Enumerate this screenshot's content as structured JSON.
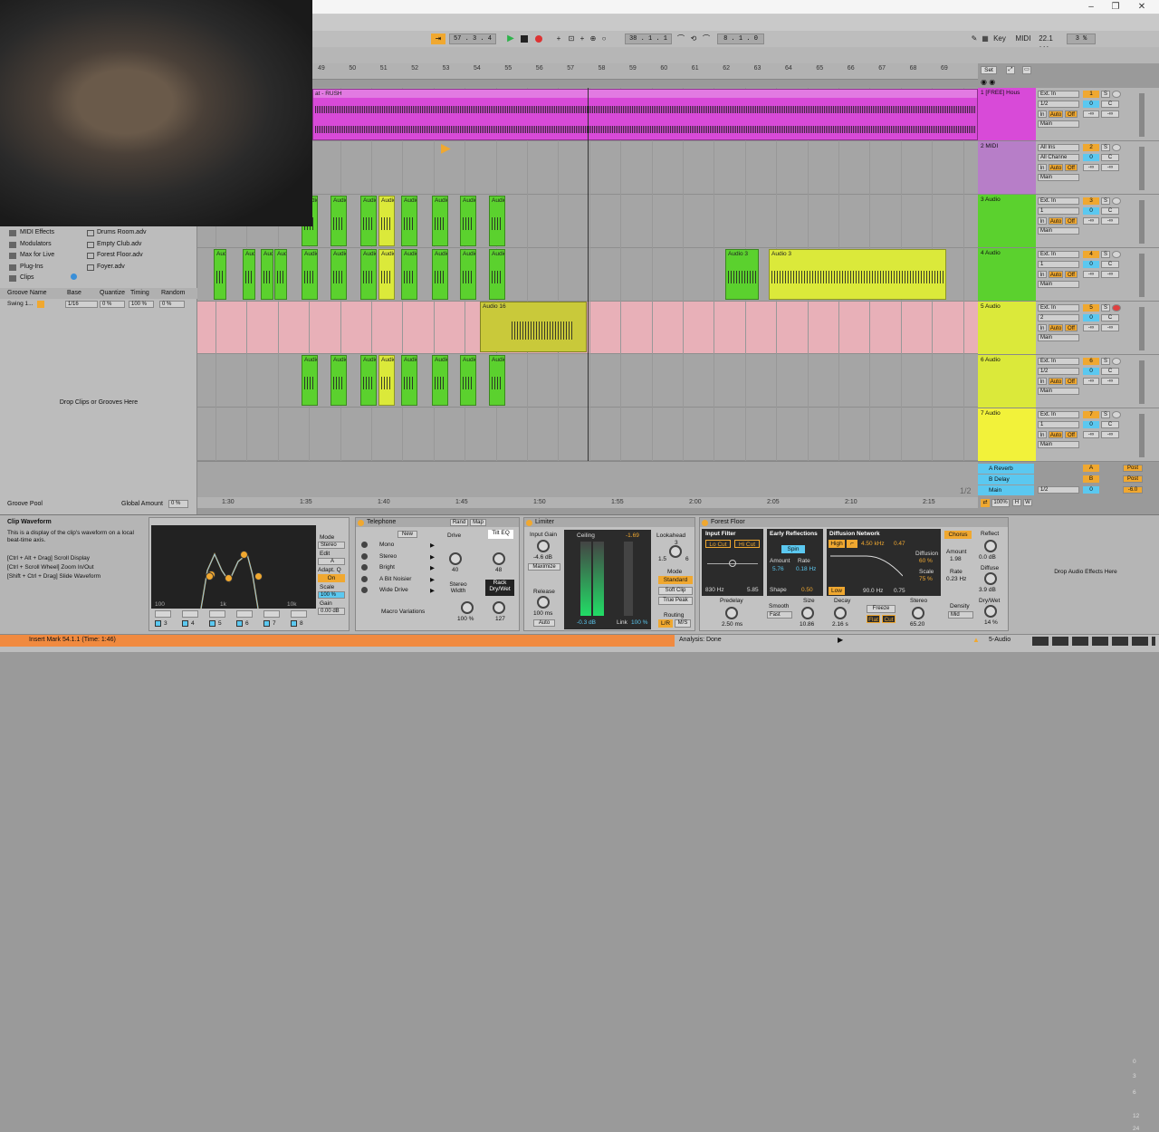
{
  "window": {
    "minimize": "–",
    "restore": "❐",
    "close": "✕"
  },
  "transport": {
    "position": "57 . 3 . 4",
    "loop_start": "38 . 1 . 1",
    "loop_length": "8 . 1 . 0",
    "key": "Key",
    "midi": "MIDI",
    "sample_rate": "22.1 kHz",
    "cpu": "3 %"
  },
  "ruler": {
    "bars": [
      "49",
      "50",
      "51",
      "52",
      "53",
      "54",
      "55",
      "56",
      "57",
      "58",
      "59",
      "60",
      "61",
      "62",
      "63",
      "64",
      "65",
      "66",
      "67",
      "68",
      "69"
    ],
    "set_label": "Set"
  },
  "time_axis": [
    "1:30",
    "1:35",
    "1:40",
    "1:45",
    "1:50",
    "1:55",
    "2:00",
    "2:05",
    "2:10",
    "2:15"
  ],
  "page_indicator": "1/2",
  "clips": {
    "rush": "at - RUSH",
    "audio": "Audio",
    "audio_short": "Aud",
    "audio_a": "Au",
    "audio3": "Audio 3",
    "audio16": "Audio 16"
  },
  "tracks": [
    {
      "name": "1 [FREE] Hous",
      "input": "Ext. In",
      "channel": "1/2",
      "number": "1",
      "out": "Main",
      "color": "#d84ad8"
    },
    {
      "name": "2 MIDI",
      "input": "All Ins",
      "channel": "All Channe",
      "number": "2",
      "out": "Main",
      "color": "#b77ec8"
    },
    {
      "name": "3 Audio",
      "input": "Ext. In",
      "channel": "1",
      "number": "3",
      "out": "Main",
      "color": "#5bd12e"
    },
    {
      "name": "4 Audio",
      "input": "Ext. In",
      "channel": "1",
      "number": "4",
      "out": "Main",
      "color": "#5bd12e"
    },
    {
      "name": "5 Audio",
      "input": "Ext. In",
      "channel": "2",
      "number": "5",
      "out": "Main",
      "color": "#dbe93a"
    },
    {
      "name": "6 Audio",
      "input": "Ext. In",
      "channel": "1/2",
      "number": "6",
      "out": "Main",
      "color": "#dbe93a"
    },
    {
      "name": "7 Audio",
      "input": "Ext. In",
      "channel": "1",
      "number": "7",
      "out": "Main",
      "color": "#f2f23a"
    }
  ],
  "monitor": {
    "in": "In",
    "auto": "Auto",
    "off": "Off",
    "zero": "0",
    "c": "C",
    "inf": "-∞",
    "s": "S"
  },
  "returns": [
    {
      "name": "A Reverb",
      "letter": "A",
      "post": "Post"
    },
    {
      "name": "B Delay",
      "letter": "B",
      "post": "Post"
    },
    {
      "name": "Main",
      "letter": "0",
      "post": "-6.0"
    }
  ],
  "main_row": {
    "zoom": "100%",
    "h": "H",
    "w": "W",
    "out": "1/2"
  },
  "browser": {
    "items": [
      "MIDI Effects",
      "Modulators",
      "Max for Live",
      "Plug-Ins",
      "Clips"
    ],
    "files": [
      "Drums Room.adv",
      "Empty Club.adv",
      "Forest Floor.adv",
      "Foyer.adv"
    ],
    "groove_headers": [
      "Groove Name",
      "Base",
      "Quantize",
      "Timing",
      "Random"
    ],
    "groove_row": {
      "name": "Swing 1...",
      "base": "1/16",
      "quantize": "0 %",
      "timing": "100 %",
      "random": "0 %"
    },
    "drop_text": "Drop Clips or Grooves Here",
    "pool_label": "Groove Pool",
    "global_amount_label": "Global Amount",
    "global_amount": "0 %"
  },
  "info": {
    "title": "Clip Waveform",
    "body": "This is a display of the clip's waveform on a local beat-time axis.",
    "shortcuts": [
      "[Ctrl + Alt + Drag] Scroll Display",
      "[Ctrl + Scroll Wheel] Zoom In/Out",
      "[Shift + Ctrl + Drag] Slide Waveform"
    ]
  },
  "eq": {
    "freq_labels": [
      "100",
      "1k",
      "10k"
    ],
    "mode_label": "Mode",
    "mode": "Stereo",
    "edit_label": "Edit",
    "edit": "A",
    "adapt_label": "Adapt. Q",
    "adapt": "On",
    "scale_label": "Scale",
    "scale": "100 %",
    "gain_label": "Gain",
    "gain": "0.00 dB",
    "bands": [
      "3",
      "4",
      "5",
      "6",
      "7",
      "8"
    ]
  },
  "telephone": {
    "title": "Telephone",
    "new": "New",
    "rand": "Rand",
    "map": "Map",
    "presets": [
      "Mono",
      "Stereo",
      "Bright",
      "A Bit Noisier",
      "Wide Drive"
    ],
    "drive_label": "Drive",
    "drive": "40",
    "tilt_label": "Tilt EQ",
    "tilt": "48",
    "width_label": "Stereo Width",
    "width": "100 %",
    "rack_label": "Rack Dry/Wet",
    "rack": "127",
    "macro": "Macro Variations"
  },
  "limiter": {
    "title": "Limiter",
    "input_gain_label": "Input Gain",
    "input_gain": "-4.6 dB",
    "maximize": "Maximize",
    "release_label": "Release",
    "release": "100 ms",
    "auto": "Auto",
    "ceiling_label": "Ceiling",
    "ceiling": "-1.69",
    "scale": [
      "0",
      "3",
      "6",
      "12",
      "24"
    ],
    "gr": "-0.3 dB",
    "link_label": "Link",
    "link": "100 %",
    "lookahead_label": "Lookahead",
    "lookahead_vals": [
      "1.5",
      "3",
      "6"
    ],
    "mode_label": "Mode",
    "modes": [
      "Standard",
      "Soft Clip",
      "True Peak"
    ],
    "routing_label": "Routing",
    "routing": [
      "L/R",
      "M/S"
    ]
  },
  "forest": {
    "title": "Forest Floor",
    "input_filter": "Input Filter",
    "lo_cut": "Lo Cut",
    "hi_cut": "Hi Cut",
    "f1": "830 Hz",
    "f2": "5.85",
    "early": "Early Reflections",
    "spin": "Spin",
    "amount_label": "Amount",
    "amount": "5.76",
    "rate_label": "Rate",
    "rate": "0.18 Hz",
    "shape_label": "Shape",
    "shape": "0.50",
    "diffusion_net": "Diffusion Network",
    "high": "High",
    "freq": "4.50 kHz",
    "q": "0.47",
    "diffusion_label": "Diffusion",
    "diffusion": "60 %",
    "scale_label": "Scale",
    "scale": "75 %",
    "low": "Low",
    "low_freq": "90.0 Hz",
    "low_q": "0.75",
    "chorus": "Chorus",
    "ch_amount_label": "Amount",
    "ch_amount": "1.98",
    "ch_rate_label": "Rate",
    "ch_rate": "0.23 Hz",
    "predelay_label": "Predelay",
    "predelay": "2.50 ms",
    "smooth_label": "Smooth",
    "smooth": "Fast",
    "size_label": "Size",
    "size": "10.86",
    "decay_label": "Decay",
    "decay": "2.16 s",
    "freeze": "Freeze",
    "flat": "Flat",
    "cut": "Cut",
    "stereo_label": "Stereo",
    "stereo": "65.20",
    "density_label": "Density",
    "density": "Mid",
    "reflect_label": "Reflect",
    "reflect": "0.0 dB",
    "diffuse_label": "Diffuse",
    "diffuse": "3.9 dB",
    "drywet_label": "Dry/Wet",
    "drywet": "14 %"
  },
  "drop_effects": "Drop Audio Effects Here",
  "status": {
    "left": "Insert Mark 54.1.1 (Time: 1:46)",
    "analysis": "Analysis: Done",
    "track": "5-Audio"
  },
  "colors": {
    "magenta": "#d84ad8",
    "green": "#5bd12e",
    "lime": "#dbe93a",
    "pink": "#e8b0b8",
    "orange": "#f0a830"
  }
}
